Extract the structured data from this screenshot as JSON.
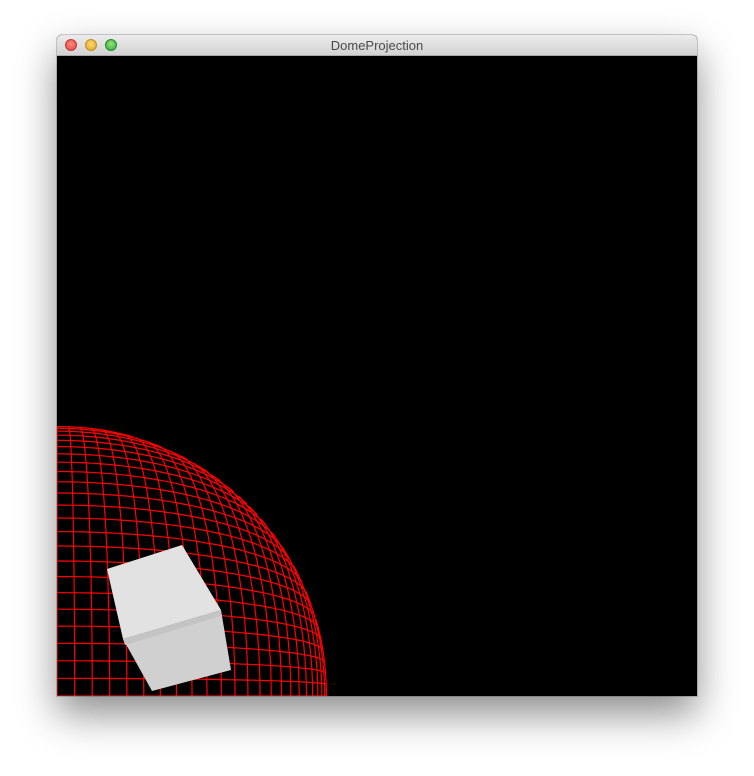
{
  "window": {
    "title": "DomeProjection"
  },
  "scene": {
    "background_color": "#000000",
    "grid_color": "#ff0000",
    "cube_colors": {
      "top": "#e4e4e4",
      "front": "#d2d2d2",
      "edge": "#c8c8c8"
    }
  },
  "icons": {
    "close": "close-circle-icon",
    "minimize": "minimize-circle-icon",
    "zoom": "zoom-circle-icon"
  }
}
